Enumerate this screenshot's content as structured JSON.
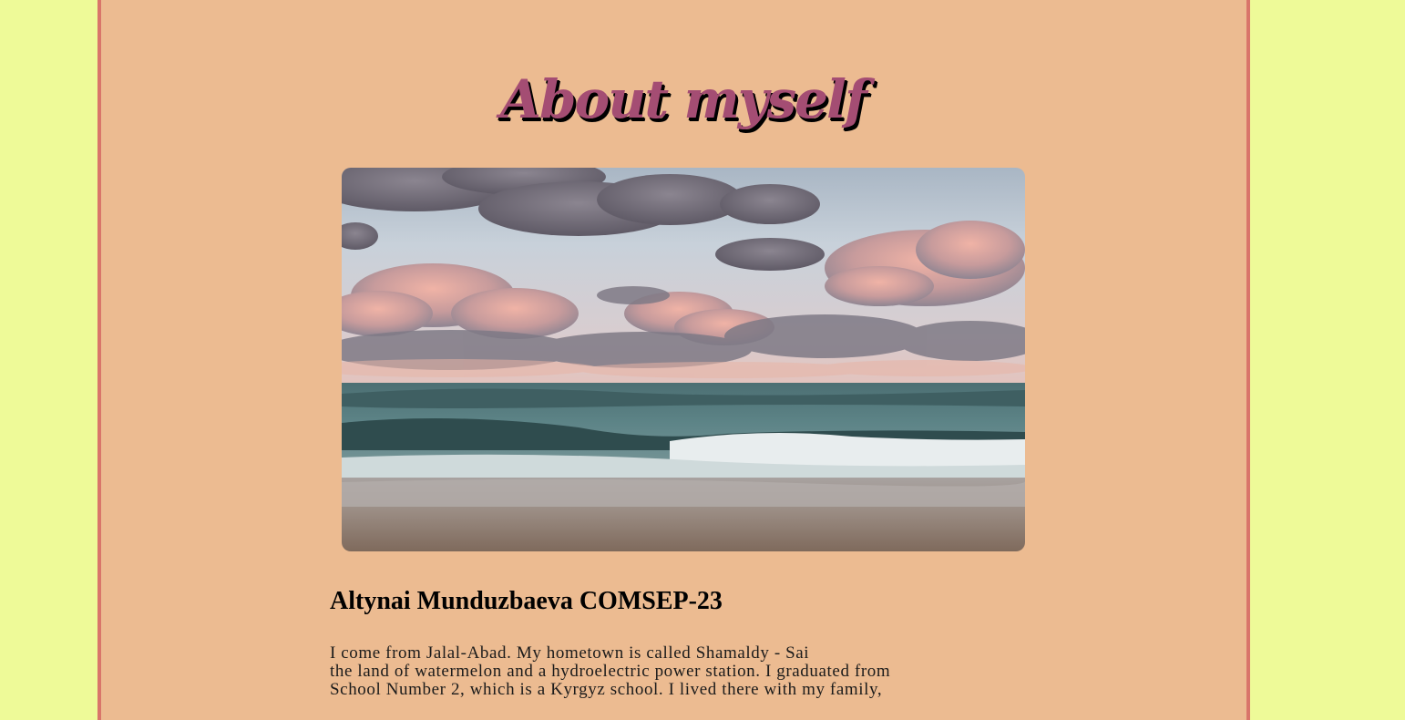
{
  "page": {
    "title": "About myself",
    "hero_image": "beach-sunset-photo",
    "name_heading": "Altynai Munduzbaeva COMSEP-23",
    "bio_lines": [
      "I come from Jalal-Abad. My hometown is called Shamaldy - Sai",
      "the land of watermelon and a hydroelectric power station. I graduated from",
      "School Number 2, which is a Kyrgyz school. I lived there with my family,",
      ""
    ]
  },
  "colors": {
    "outer_background": "#eefa98",
    "page_background": "#ecbb91",
    "page_border": "#d9756a",
    "title_fill": "#a44d73",
    "title_shadow": "#000000"
  }
}
